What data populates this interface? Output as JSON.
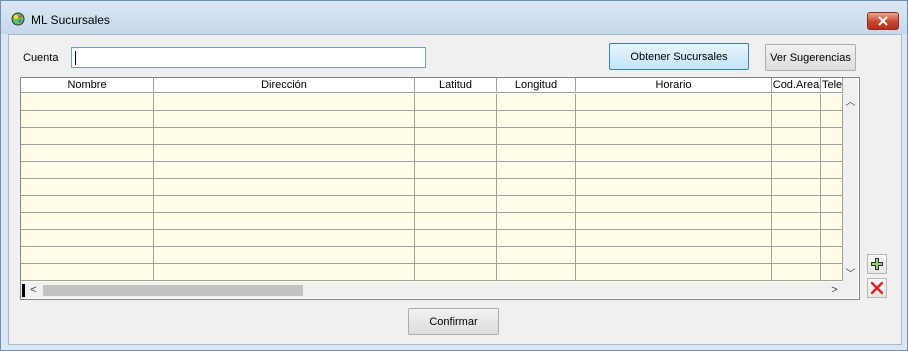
{
  "window": {
    "title": "ML Sucursales",
    "close_label": "✕"
  },
  "form": {
    "cuenta_label": "Cuenta",
    "cuenta_value": "",
    "obtener_button": "Obtener Sucursales",
    "ver_button": "Ver Sugerencias",
    "confirmar_button": "Confirmar"
  },
  "grid": {
    "columns": [
      "Nombre",
      "Dirección",
      "Latitud",
      "Longitud",
      "Horario",
      "Cod.Area",
      "Telef"
    ],
    "empty_rows": 11
  },
  "scrollbars": {
    "up": "︿",
    "down": "﹀",
    "left": "<",
    "right": ">"
  },
  "colors": {
    "row_background": "#fffde7",
    "accent_button": "#c3e4f8",
    "delete_icon": "#e0241c"
  },
  "icons": {
    "app": "globe-icon",
    "add": "plus-icon",
    "delete": "x-icon",
    "close": "close-icon"
  }
}
